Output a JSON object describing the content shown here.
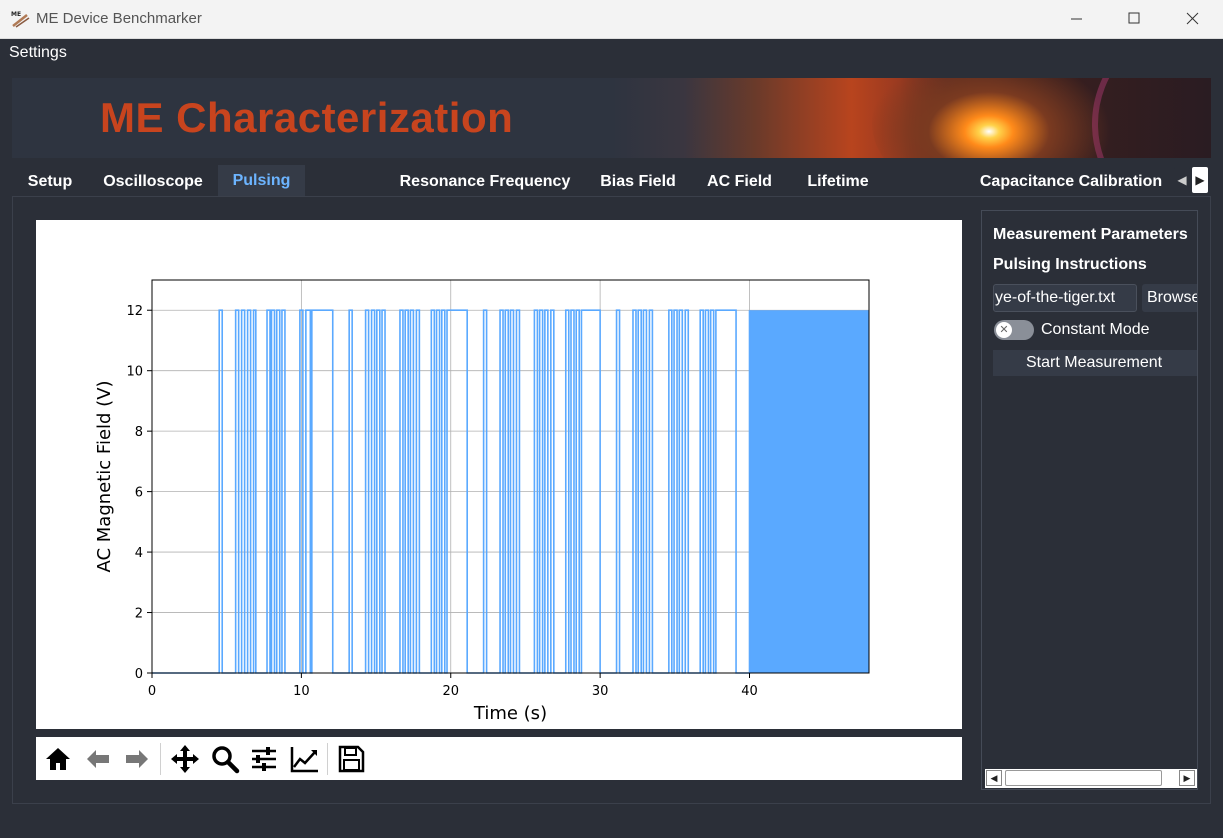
{
  "window": {
    "title": "ME Device Benchmarker"
  },
  "menu": {
    "settings": "Settings"
  },
  "banner": {
    "title": "ME Characterization"
  },
  "tabs": [
    {
      "label": "Setup",
      "active": false
    },
    {
      "label": "Oscilloscope",
      "active": false
    },
    {
      "label": "Pulsing",
      "active": true
    },
    {
      "label": "Resonance Frequency",
      "active": false
    },
    {
      "label": "Bias Field",
      "active": false
    },
    {
      "label": "AC Field",
      "active": false
    },
    {
      "label": "Lifetime",
      "active": false
    },
    {
      "label": "Capacitance Calibration",
      "active": false
    }
  ],
  "side_panel": {
    "measurement_parameters": "Measurement Parameters",
    "pulsing_instructions": "Pulsing Instructions",
    "file_value": "ye-of-the-tiger.txt",
    "browse_label": "Browse",
    "constant_mode_label": "Constant Mode",
    "constant_mode_on": false,
    "start_label": "Start Measurement"
  },
  "toolbar": {
    "buttons": [
      "home-icon",
      "back-icon",
      "forward-icon",
      "pan-icon",
      "zoom-icon",
      "configure-subplots-icon",
      "edit-axis-icon",
      "save-icon"
    ]
  },
  "chart_data": {
    "type": "line",
    "xlabel": "Time (s)",
    "ylabel": "AC Magnetic Field (V)",
    "xlim": [
      0,
      48
    ],
    "ylim": [
      0,
      13
    ],
    "xticks": [
      0,
      10,
      20,
      30,
      40
    ],
    "yticks": [
      0,
      2,
      4,
      6,
      8,
      10,
      12
    ],
    "grid": true,
    "color": "#5aa9ff",
    "pulse_level": 12,
    "pulses_on": [
      [
        4.5,
        4.7
      ],
      [
        5.6,
        5.8
      ],
      [
        6.0,
        6.2
      ],
      [
        6.4,
        6.6
      ],
      [
        6.8,
        6.95
      ],
      [
        7.7,
        7.9
      ],
      [
        8.0,
        8.2
      ],
      [
        8.35,
        8.55
      ],
      [
        8.7,
        8.9
      ],
      [
        9.9,
        10.1
      ],
      [
        10.3,
        10.6
      ],
      [
        10.7,
        12.1
      ],
      [
        13.2,
        13.4
      ],
      [
        14.3,
        14.5
      ],
      [
        14.7,
        14.9
      ],
      [
        15.05,
        15.25
      ],
      [
        15.4,
        15.6
      ],
      [
        16.6,
        16.8
      ],
      [
        16.95,
        17.15
      ],
      [
        17.3,
        17.5
      ],
      [
        17.7,
        17.9
      ],
      [
        18.7,
        18.9
      ],
      [
        19.05,
        19.25
      ],
      [
        19.4,
        19.6
      ],
      [
        19.75,
        21.1
      ],
      [
        22.2,
        22.4
      ],
      [
        23.3,
        23.5
      ],
      [
        23.65,
        23.85
      ],
      [
        24.0,
        24.2
      ],
      [
        24.4,
        24.6
      ],
      [
        25.6,
        25.8
      ],
      [
        25.95,
        26.15
      ],
      [
        26.3,
        26.5
      ],
      [
        26.7,
        26.9
      ],
      [
        27.7,
        27.9
      ],
      [
        28.05,
        28.25
      ],
      [
        28.4,
        28.6
      ],
      [
        28.75,
        30.0
      ],
      [
        31.1,
        31.3
      ],
      [
        32.2,
        32.4
      ],
      [
        32.55,
        32.75
      ],
      [
        32.9,
        33.1
      ],
      [
        33.3,
        33.5
      ],
      [
        34.6,
        34.8
      ],
      [
        34.95,
        35.15
      ],
      [
        35.3,
        35.5
      ],
      [
        35.7,
        35.9
      ],
      [
        36.7,
        36.9
      ],
      [
        37.05,
        37.25
      ],
      [
        37.4,
        37.6
      ],
      [
        37.75,
        39.1
      ]
    ],
    "constant_on_from": 40
  }
}
